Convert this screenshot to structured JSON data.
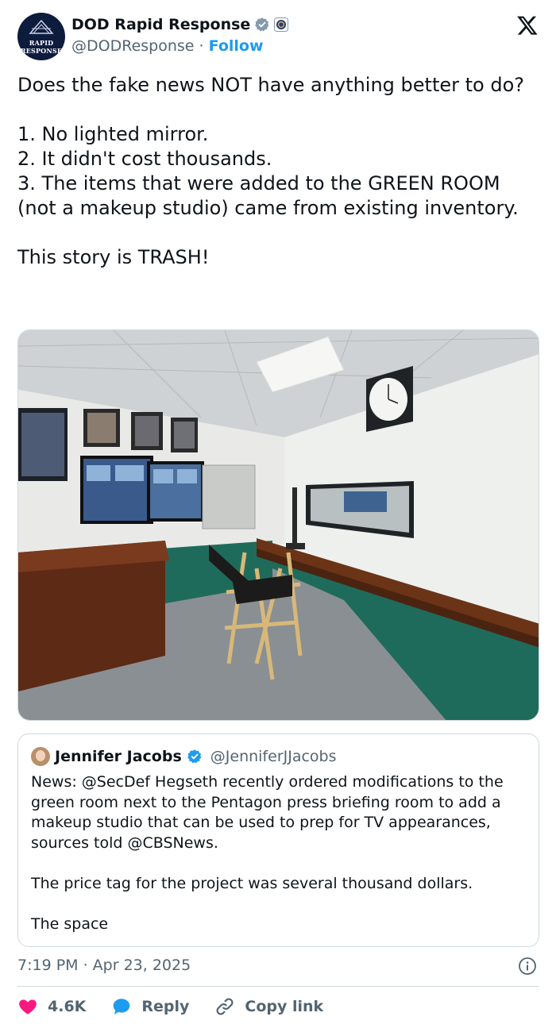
{
  "author": {
    "display_name": "DOD Rapid Response",
    "handle": "@DODResponse",
    "separator": "·",
    "follow_label": "Follow",
    "avatar_line1": "RAPID",
    "avatar_line2": "RESPONSE",
    "avatar_color": "#0d1b3d"
  },
  "tweet": {
    "text": "Does the fake news NOT have anything better to do?\n\n1. No lighted mirror.\n2. It didn't cost thousands.\n3. The items that were added to the GREEN ROOM (not a makeup studio) came from existing inventory.\n\nThis story is TRASH!",
    "timestamp": "7:19 PM · Apr 23, 2025"
  },
  "quoted": {
    "display_name": "Jennifer Jacobs",
    "handle": "@JenniferJJacobs",
    "text": "News: @SecDef Hegseth recently ordered modifications to the green room next to the Pentagon press briefing room to add a makeup studio that can be used to prep for TV appearances, sources told @CBSNews.\n\nThe price tag for the project was several thousand dollars.\n\nThe space"
  },
  "actions": {
    "likes": "4.6K",
    "reply_label": "Reply",
    "copy_label": "Copy link"
  },
  "icons": {
    "verified": "verified-badge-icon",
    "affiliate": "government-affiliate-icon",
    "brand": "x-logo-icon",
    "like": "heart-icon",
    "reply": "reply-bubble-icon",
    "copy": "link-icon",
    "info": "info-icon"
  },
  "colors": {
    "accent": "#1d9bf0",
    "like": "#f91880",
    "muted": "#536471",
    "text": "#0f1419",
    "border": "#cfd9de"
  }
}
